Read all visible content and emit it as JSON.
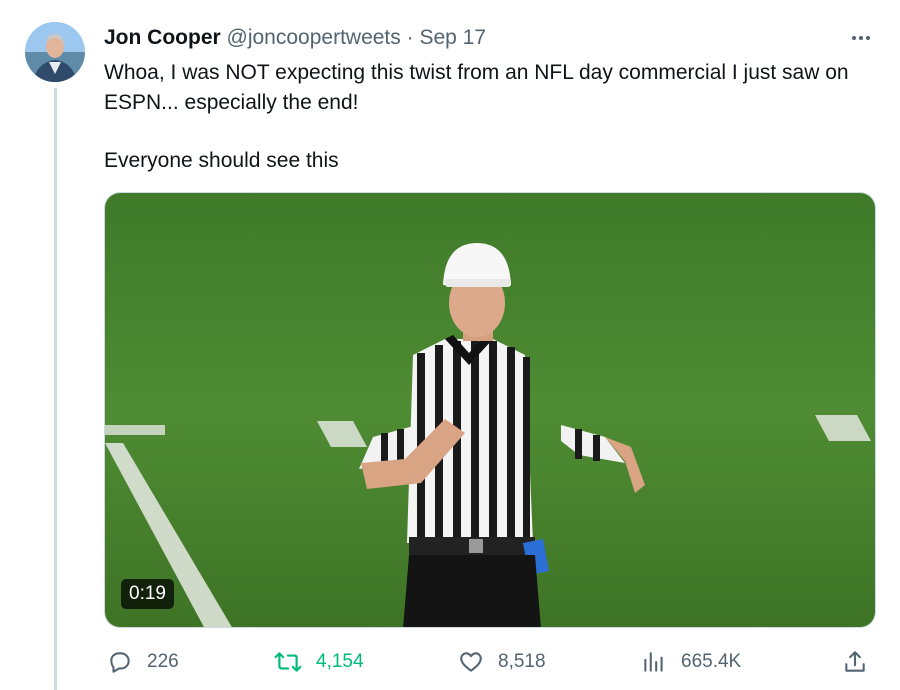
{
  "tweet": {
    "author_name": "Jon Cooper",
    "handle": "@joncoopertweets",
    "separator": "·",
    "date": "Sep 17",
    "text_line1": "Whoa, I was NOT expecting this twist from an NFL day commercial I just saw on ESPN... especially the end!",
    "text_line2": "Everyone should see this",
    "video_duration": "0:19"
  },
  "actions": {
    "reply_count": "226",
    "retweet_count": "4,154",
    "like_count": "8,518",
    "view_count": "665.4K"
  },
  "icons": {
    "more": "more-icon",
    "reply": "reply-icon",
    "retweet": "retweet-icon",
    "like": "heart-icon",
    "views": "views-icon",
    "share": "share-icon"
  },
  "colors": {
    "text": "#0f1419",
    "secondary": "#536471",
    "retweet_active": "#00ba7c",
    "thread_line": "#cfd9de",
    "field_green": "#4d8a31"
  }
}
